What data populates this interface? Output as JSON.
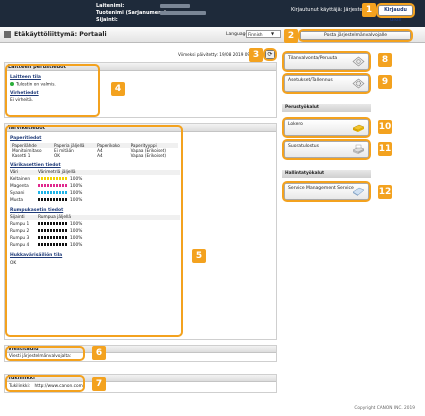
{
  "header": {
    "device_name_label": "Laitenimi:",
    "product_name_label": "Tuotenimi (Sarjanumero):",
    "location_label": "Sijainti:",
    "login_user_label": "Kirjautunut käyttäjä: Järjestelmänvalvoja",
    "logout_label": "Kirjaudu ulos"
  },
  "titlebar": {
    "title": "Etäkäyttöliittymä: Portaali",
    "language_label": "Language:",
    "language_value": "Finnish",
    "mail_admin_label": "Posta järjestelmänvalvojalle"
  },
  "last_updated": "Viimeksi päivitetty: 19/08 2019 09:46:53",
  "device_info": {
    "heading": "Laitteen perustiedot",
    "status_heading": "Laitteen tila",
    "status_value": "Tulostin on valmis.",
    "errors_heading": "Virhetiedot",
    "errors_value": "Ei virheitä."
  },
  "consumables": {
    "heading": "Tarviketiedot",
    "paper_heading": "Paperitiedot",
    "paper_columns": [
      "Paperilähde",
      "Paperia jäljellä",
      "Paperikoko",
      "Paperityyppi"
    ],
    "paper_rows": [
      [
        "Monitoimitaso",
        "Ei mitään",
        "A4",
        "Vapaa (Erikoiset)"
      ],
      [
        "Kasetti 1",
        "OK",
        "A4",
        "Vapaa (Erikoiset)"
      ]
    ],
    "cartridge_heading": "Värikasettien tiedot",
    "cartridge_columns": [
      "Väri",
      "Värimetrlä jäljellä"
    ],
    "cartridges": [
      {
        "name": "Keltainen",
        "pct": "100%",
        "color": "#f4d300"
      },
      {
        "name": "Magenta",
        "pct": "100%",
        "color": "#e0278d"
      },
      {
        "name": "Syaani",
        "pct": "100%",
        "color": "#1fb4e8"
      },
      {
        "name": "Musta",
        "pct": "100%",
        "color": "#111111"
      }
    ],
    "drum_heading": "Rumpukasetin tiedot",
    "drum_columns": [
      "Sijainti",
      "Rumpua jäljellä"
    ],
    "drums": [
      {
        "name": "Rumpu 1",
        "pct": "100%"
      },
      {
        "name": "Rumpu 2",
        "pct": "100%"
      },
      {
        "name": "Rumpu 3",
        "pct": "100%"
      },
      {
        "name": "Rumpu 4",
        "pct": "100%"
      }
    ],
    "waste_heading": "Hukkavärisäiliön tila",
    "waste_value": "OK"
  },
  "message": {
    "heading": "Viestitaulu",
    "value": "Viesti järjestelmänvalvojalta:"
  },
  "support": {
    "heading": "Tukilinkki",
    "label": "Tukilinkki:",
    "url": "http://www.canon.com"
  },
  "right": {
    "status_monitor": "Tilanvalvonta/Peruuta",
    "settings": "Asetukset/Tallennus",
    "basic_section": "Perustyökalut",
    "mailbox": "Lokero",
    "direct_print": "Suoratulostus",
    "mgmt_section": "Hallintatyökalut",
    "sms": "Service Management Service"
  },
  "callouts": [
    "1",
    "2",
    "3",
    "4",
    "5",
    "6",
    "7",
    "8",
    "9",
    "10",
    "11",
    "12"
  ],
  "colors": {
    "accent": "#f3a21f",
    "topbar": "#1e2a3a"
  },
  "footer": "Copyright CANON INC. 2019"
}
